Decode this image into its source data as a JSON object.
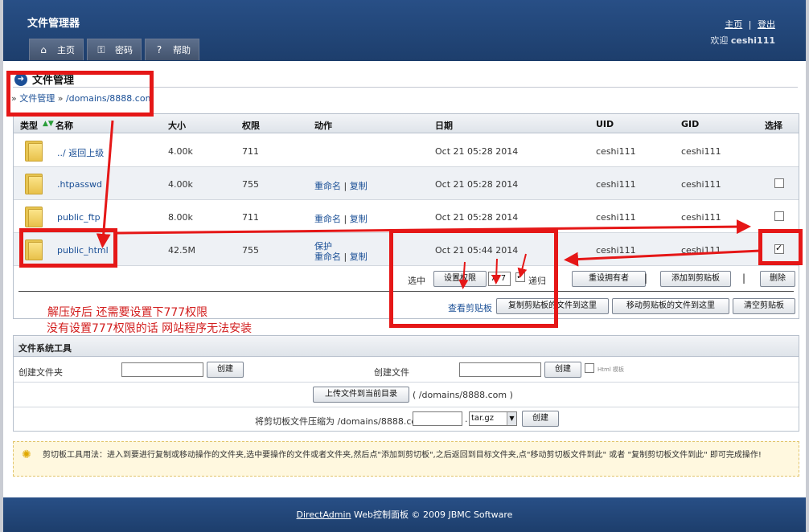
{
  "header": {
    "app_title": "文件管理器",
    "link_home": "主页",
    "link_sep": "|",
    "link_logout": "登出",
    "welcome_prefix": "欢迎",
    "username": "ceshi111",
    "tabs": [
      {
        "label": "主页",
        "icon": "home-icon"
      },
      {
        "label": "密码",
        "icon": "key-icon"
      },
      {
        "label": "帮助",
        "icon": "help-icon"
      }
    ]
  },
  "section": {
    "title": "文件管理",
    "breadcrumb_root": "文件管理",
    "breadcrumb_sep": "»",
    "breadcrumb_path": "/domains/8888.com"
  },
  "table": {
    "columns": {
      "type": "类型",
      "name": "名称",
      "size": "大小",
      "perm": "权限",
      "action": "动作",
      "date": "日期",
      "uid": "UID",
      "gid": "GID",
      "select": "选择"
    },
    "rows": [
      {
        "name": "../ 返回上级",
        "size": "4.00k",
        "perm": "711",
        "action1": "",
        "action2": "",
        "action3": "",
        "date": "Oct 21 05:28 2014",
        "uid": "ceshi111",
        "gid": "ceshi111",
        "checked": null
      },
      {
        "name": ".htpasswd",
        "size": "4.00k",
        "perm": "755",
        "action1": "重命名",
        "action2": "复制",
        "action3": "",
        "date": "Oct 21 05:28 2014",
        "uid": "ceshi111",
        "gid": "ceshi111",
        "checked": false
      },
      {
        "name": "public_ftp",
        "size": "8.00k",
        "perm": "711",
        "action1": "重命名",
        "action2": "复制",
        "action3": "",
        "date": "Oct 21 05:28 2014",
        "uid": "ceshi111",
        "gid": "ceshi111",
        "checked": false
      },
      {
        "name": "public_html",
        "size": "42.5M",
        "perm": "755",
        "action1": "重命名",
        "action2": "复制",
        "action3": "保护",
        "date": "Oct 21 05:44 2014",
        "uid": "ceshi111",
        "gid": "ceshi111",
        "checked": true
      }
    ],
    "action_sep": "|",
    "selected_label": "选中",
    "set_perm_button": "设置权限",
    "perm_value": "777",
    "recursive_label": "递归",
    "recursive_checked": true,
    "reset_owner_button": "重设拥有者",
    "add_clipboard_button": "添加到剪贴板",
    "delete_button": "删除",
    "view_clipboard_link": "查看剪贴板",
    "copy_here_button": "复制剪贴板的文件到这里",
    "move_here_button": "移动剪贴板的文件到这里",
    "clear_clipboard_button": "清空剪贴板"
  },
  "annotation": {
    "line1": "解压好后 还需要设置下777权限",
    "line2": "没有设置777权限的话 网站程序无法安装",
    "color": "#e51717"
  },
  "tools": {
    "title": "文件系统工具",
    "create_folder_label": "创建文件夹",
    "create_folder_button": "创建",
    "create_file_label": "创建文件",
    "create_file_button": "创建",
    "html_template_label": "Html 模板",
    "upload_button": "上传文件到当前目录",
    "upload_path": "( /domains/8888.com )",
    "compress_label": "将剪切板文件压缩为 /domains/8888.com",
    "compress_dot": ".",
    "compress_format": "tar.gz",
    "compress_button": "创建"
  },
  "note": {
    "text": "剪切板工具用法：进入到要进行复制或移动操作的文件夹,选中要操作的文件或者文件夹,然后点\"添加到剪切板\",之后返回到目标文件夹,点\"移动剪切板文件到此\" 或者 \"复制剪切板文件到此\" 即可完成操作!"
  },
  "footer": {
    "link": "DirectAdmin",
    "text": " Web控制面板 © 2009 JBMC Software"
  },
  "colors": {
    "header_bg": "#284f86",
    "link": "#1a4f96",
    "annotation_red": "#e51717"
  }
}
